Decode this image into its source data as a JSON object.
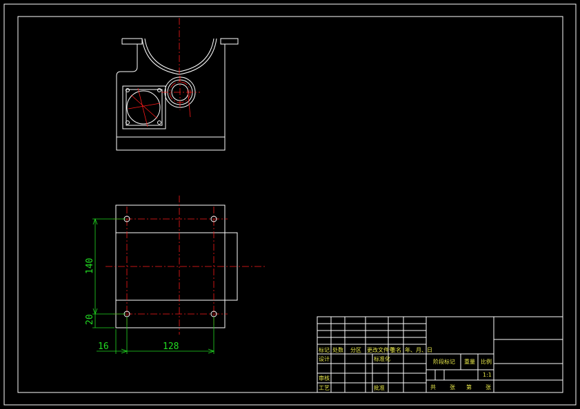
{
  "dimensions": {
    "vertical_large": "140",
    "vertical_small": "20",
    "horizontal_small": "16",
    "horizontal_large": "128"
  },
  "title_block": {
    "row_headers": [
      "标记",
      "处数",
      "分区",
      "更改文件号",
      "签名",
      "年、月、日"
    ],
    "design": "设计",
    "standardization": "标准化",
    "review": "审核",
    "process": "工艺",
    "approve": "批准",
    "stage_mark": "阶段标记",
    "weight": "重量",
    "scale": "比例",
    "scale_value": "1:1",
    "total": "共",
    "sheets": "张",
    "no": "第",
    "sheet2": "张"
  }
}
